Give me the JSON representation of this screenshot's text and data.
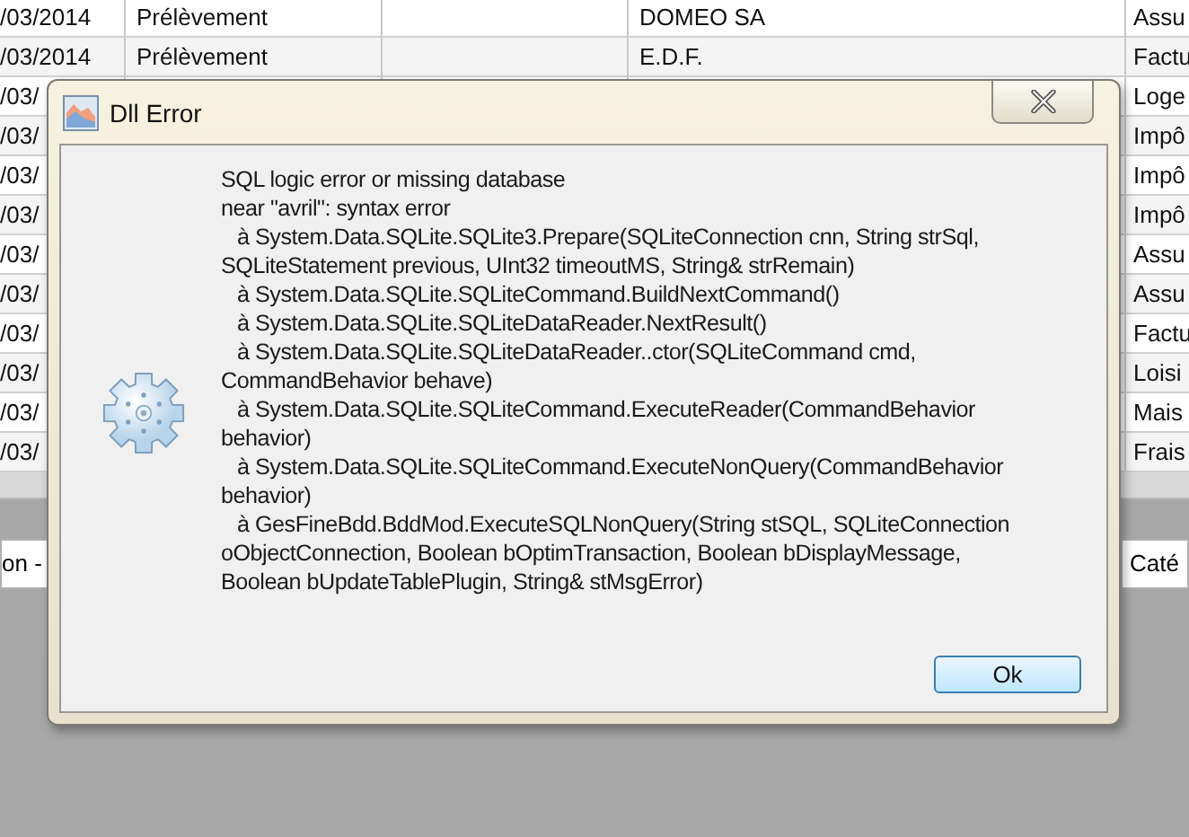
{
  "table": {
    "rows": [
      {
        "cells": [
          "/03/2014",
          "Prélèvement",
          "",
          "DOMEO SA",
          "Assu"
        ]
      },
      {
        "cells": [
          "/03/2014",
          "Prélèvement",
          "",
          "E.D.F.",
          "Factu"
        ]
      },
      {
        "cells": [
          "/03/",
          "",
          "",
          "",
          "Loge"
        ]
      },
      {
        "cells": [
          "/03/",
          "",
          "",
          "",
          "Impô"
        ]
      },
      {
        "cells": [
          "/03/",
          "",
          "",
          "",
          "Impô"
        ]
      },
      {
        "cells": [
          "/03/",
          "",
          "",
          "",
          "Impô"
        ]
      },
      {
        "cells": [
          "/03/",
          "",
          "",
          "",
          "Assu"
        ]
      },
      {
        "cells": [
          "/03/",
          "",
          "",
          "",
          "Assu"
        ]
      },
      {
        "cells": [
          "/03/",
          "",
          "",
          "",
          "Factu"
        ]
      },
      {
        "cells": [
          "/03/",
          "",
          "",
          "",
          "Loisi"
        ]
      },
      {
        "cells": [
          "/03/",
          "",
          "",
          "",
          "Mais"
        ]
      },
      {
        "cells": [
          "/03/",
          "",
          "",
          "",
          "Frais"
        ]
      }
    ]
  },
  "filter_bar": {
    "fields": [
      "on -",
      "Caté"
    ]
  },
  "dialog": {
    "title": "Dll Error",
    "message_lines": [
      {
        "text": "SQL logic error or missing database",
        "indent": false
      },
      {
        "text": "near \"avril\": syntax error",
        "indent": false
      },
      {
        "text": "à System.Data.SQLite.SQLite3.Prepare(SQLiteConnection cnn, String strSql,",
        "indent": true
      },
      {
        "text": "SQLiteStatement previous, UInt32 timeoutMS, String& strRemain)",
        "indent": false
      },
      {
        "text": "à System.Data.SQLite.SQLiteCommand.BuildNextCommand()",
        "indent": true
      },
      {
        "text": "à System.Data.SQLite.SQLiteDataReader.NextResult()",
        "indent": true
      },
      {
        "text": "à System.Data.SQLite.SQLiteDataReader..ctor(SQLiteCommand cmd,",
        "indent": true
      },
      {
        "text": "CommandBehavior behave)",
        "indent": false
      },
      {
        "text": "à System.Data.SQLite.SQLiteCommand.ExecuteReader(CommandBehavior",
        "indent": true
      },
      {
        "text": "behavior)",
        "indent": false
      },
      {
        "text": "à System.Data.SQLite.SQLiteCommand.ExecuteNonQuery(CommandBehavior",
        "indent": true
      },
      {
        "text": "behavior)",
        "indent": false
      },
      {
        "text": "à GesFineBdd.BddMod.ExecuteSQLNonQuery(String stSQL, SQLiteConnection",
        "indent": true
      },
      {
        "text": "oObjectConnection, Boolean bOptimTransaction, Boolean bDisplayMessage,",
        "indent": false
      },
      {
        "text": "Boolean bUpdateTablePlugin, String& stMsgError)",
        "indent": false
      }
    ],
    "button": "Ok"
  }
}
